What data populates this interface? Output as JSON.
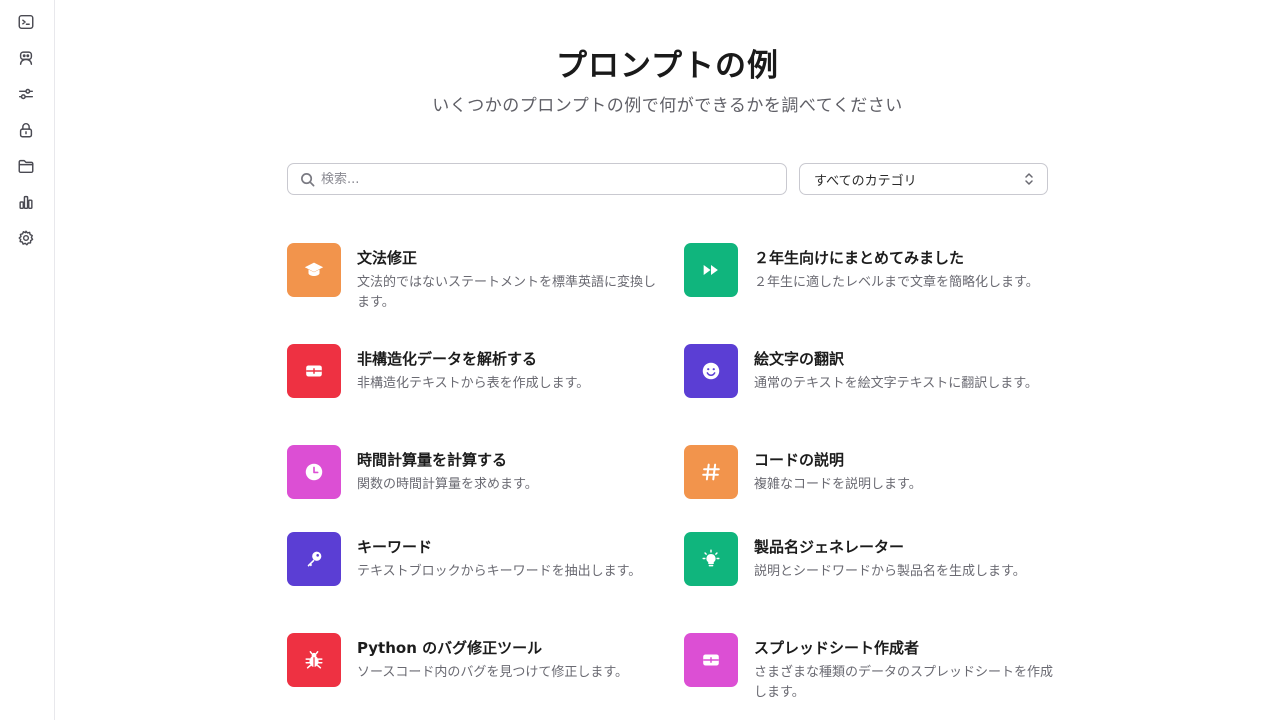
{
  "sidebar": {
    "items": [
      {
        "icon": "terminal-icon"
      },
      {
        "icon": "robot-icon"
      },
      {
        "icon": "sliders-icon"
      },
      {
        "icon": "lock-icon"
      },
      {
        "icon": "folder-icon"
      },
      {
        "icon": "bar-chart-icon"
      },
      {
        "icon": "gear-icon"
      }
    ]
  },
  "header": {
    "title": "プロンプトの例",
    "subtitle": "いくつかのプロンプトの例で何ができるかを調べてください"
  },
  "search": {
    "placeholder": "検索...",
    "value": ""
  },
  "category_select": {
    "value": "すべてのカテゴリ"
  },
  "colors": {
    "orange": "#F2944C",
    "green": "#10B57D",
    "red": "#EE3142",
    "purple": "#5B3ED4",
    "pink": "#DC4FD4"
  },
  "cards": [
    {
      "title": "文法修正",
      "desc": "文法的ではないステートメントを標準英語に変換します。",
      "icon": "graduation-cap-icon",
      "color": "#F2944C"
    },
    {
      "title": "２年生向けにまとめてみました",
      "desc": "２年生に適したレベルまで文章を簡略化します。",
      "icon": "fast-forward-icon",
      "color": "#10B57D"
    },
    {
      "title": "非構造化データを解析する",
      "desc": "非構造化テキストから表を作成します。",
      "icon": "table-icon",
      "color": "#EE3142"
    },
    {
      "title": "絵文字の翻訳",
      "desc": "通常のテキストを絵文字テキストに翻訳します。",
      "icon": "smiley-icon",
      "color": "#5B3ED4"
    },
    {
      "title": "時間計算量を計算する",
      "desc": "関数の時間計算量を求めます。",
      "icon": "clock-icon",
      "color": "#DC4FD4"
    },
    {
      "title": "コードの説明",
      "desc": "複雑なコードを説明します。",
      "icon": "hashtag-icon",
      "color": "#F2944C"
    },
    {
      "title": "キーワード",
      "desc": "テキストブロックからキーワードを抽出します。",
      "icon": "key-icon",
      "color": "#5B3ED4"
    },
    {
      "title": "製品名ジェネレーター",
      "desc": "説明とシードワードから製品名を生成します。",
      "icon": "lightbulb-icon",
      "color": "#10B57D"
    },
    {
      "title": "Python のバグ修正ツール",
      "desc": "ソースコード内のバグを見つけて修正します。",
      "icon": "bug-icon",
      "color": "#EE3142"
    },
    {
      "title": "スプレッドシート作成者",
      "desc": "さまざまな種類のデータのスプレッドシートを作成します。",
      "icon": "spreadsheet-icon",
      "color": "#DC4FD4"
    }
  ]
}
